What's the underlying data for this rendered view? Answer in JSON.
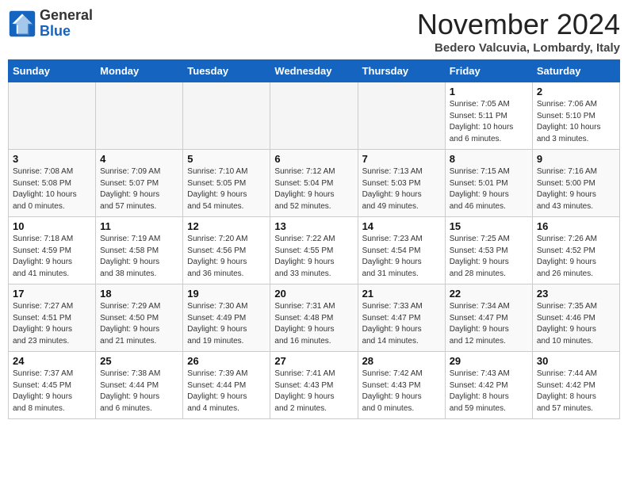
{
  "header": {
    "logo_general": "General",
    "logo_blue": "Blue",
    "title": "November 2024",
    "location": "Bedero Valcuvia, Lombardy, Italy"
  },
  "days_of_week": [
    "Sunday",
    "Monday",
    "Tuesday",
    "Wednesday",
    "Thursday",
    "Friday",
    "Saturday"
  ],
  "weeks": [
    [
      {
        "day": "",
        "info": "",
        "empty": true
      },
      {
        "day": "",
        "info": "",
        "empty": true
      },
      {
        "day": "",
        "info": "",
        "empty": true
      },
      {
        "day": "",
        "info": "",
        "empty": true
      },
      {
        "day": "",
        "info": "",
        "empty": true
      },
      {
        "day": "1",
        "info": "Sunrise: 7:05 AM\nSunset: 5:11 PM\nDaylight: 10 hours\nand 6 minutes."
      },
      {
        "day": "2",
        "info": "Sunrise: 7:06 AM\nSunset: 5:10 PM\nDaylight: 10 hours\nand 3 minutes."
      }
    ],
    [
      {
        "day": "3",
        "info": "Sunrise: 7:08 AM\nSunset: 5:08 PM\nDaylight: 10 hours\nand 0 minutes."
      },
      {
        "day": "4",
        "info": "Sunrise: 7:09 AM\nSunset: 5:07 PM\nDaylight: 9 hours\nand 57 minutes."
      },
      {
        "day": "5",
        "info": "Sunrise: 7:10 AM\nSunset: 5:05 PM\nDaylight: 9 hours\nand 54 minutes."
      },
      {
        "day": "6",
        "info": "Sunrise: 7:12 AM\nSunset: 5:04 PM\nDaylight: 9 hours\nand 52 minutes."
      },
      {
        "day": "7",
        "info": "Sunrise: 7:13 AM\nSunset: 5:03 PM\nDaylight: 9 hours\nand 49 minutes."
      },
      {
        "day": "8",
        "info": "Sunrise: 7:15 AM\nSunset: 5:01 PM\nDaylight: 9 hours\nand 46 minutes."
      },
      {
        "day": "9",
        "info": "Sunrise: 7:16 AM\nSunset: 5:00 PM\nDaylight: 9 hours\nand 43 minutes."
      }
    ],
    [
      {
        "day": "10",
        "info": "Sunrise: 7:18 AM\nSunset: 4:59 PM\nDaylight: 9 hours\nand 41 minutes."
      },
      {
        "day": "11",
        "info": "Sunrise: 7:19 AM\nSunset: 4:58 PM\nDaylight: 9 hours\nand 38 minutes."
      },
      {
        "day": "12",
        "info": "Sunrise: 7:20 AM\nSunset: 4:56 PM\nDaylight: 9 hours\nand 36 minutes."
      },
      {
        "day": "13",
        "info": "Sunrise: 7:22 AM\nSunset: 4:55 PM\nDaylight: 9 hours\nand 33 minutes."
      },
      {
        "day": "14",
        "info": "Sunrise: 7:23 AM\nSunset: 4:54 PM\nDaylight: 9 hours\nand 31 minutes."
      },
      {
        "day": "15",
        "info": "Sunrise: 7:25 AM\nSunset: 4:53 PM\nDaylight: 9 hours\nand 28 minutes."
      },
      {
        "day": "16",
        "info": "Sunrise: 7:26 AM\nSunset: 4:52 PM\nDaylight: 9 hours\nand 26 minutes."
      }
    ],
    [
      {
        "day": "17",
        "info": "Sunrise: 7:27 AM\nSunset: 4:51 PM\nDaylight: 9 hours\nand 23 minutes."
      },
      {
        "day": "18",
        "info": "Sunrise: 7:29 AM\nSunset: 4:50 PM\nDaylight: 9 hours\nand 21 minutes."
      },
      {
        "day": "19",
        "info": "Sunrise: 7:30 AM\nSunset: 4:49 PM\nDaylight: 9 hours\nand 19 minutes."
      },
      {
        "day": "20",
        "info": "Sunrise: 7:31 AM\nSunset: 4:48 PM\nDaylight: 9 hours\nand 16 minutes."
      },
      {
        "day": "21",
        "info": "Sunrise: 7:33 AM\nSunset: 4:47 PM\nDaylight: 9 hours\nand 14 minutes."
      },
      {
        "day": "22",
        "info": "Sunrise: 7:34 AM\nSunset: 4:47 PM\nDaylight: 9 hours\nand 12 minutes."
      },
      {
        "day": "23",
        "info": "Sunrise: 7:35 AM\nSunset: 4:46 PM\nDaylight: 9 hours\nand 10 minutes."
      }
    ],
    [
      {
        "day": "24",
        "info": "Sunrise: 7:37 AM\nSunset: 4:45 PM\nDaylight: 9 hours\nand 8 minutes."
      },
      {
        "day": "25",
        "info": "Sunrise: 7:38 AM\nSunset: 4:44 PM\nDaylight: 9 hours\nand 6 minutes."
      },
      {
        "day": "26",
        "info": "Sunrise: 7:39 AM\nSunset: 4:44 PM\nDaylight: 9 hours\nand 4 minutes."
      },
      {
        "day": "27",
        "info": "Sunrise: 7:41 AM\nSunset: 4:43 PM\nDaylight: 9 hours\nand 2 minutes."
      },
      {
        "day": "28",
        "info": "Sunrise: 7:42 AM\nSunset: 4:43 PM\nDaylight: 9 hours\nand 0 minutes."
      },
      {
        "day": "29",
        "info": "Sunrise: 7:43 AM\nSunset: 4:42 PM\nDaylight: 8 hours\nand 59 minutes."
      },
      {
        "day": "30",
        "info": "Sunrise: 7:44 AM\nSunset: 4:42 PM\nDaylight: 8 hours\nand 57 minutes."
      }
    ]
  ]
}
